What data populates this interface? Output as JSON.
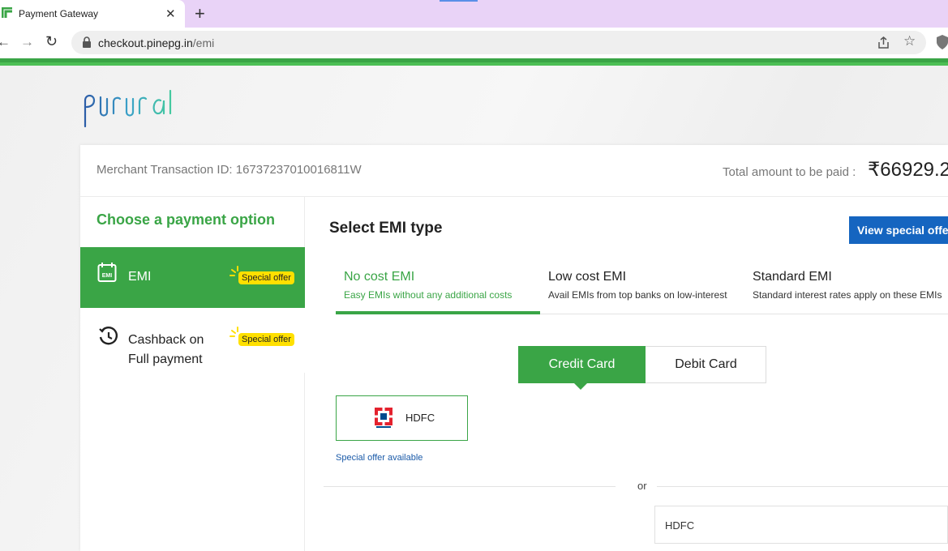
{
  "browser": {
    "tab_title": "Payment Gateway",
    "url_host": "checkout.pinepg.in",
    "url_path": "/emi"
  },
  "header": {
    "merchant_txn": "Merchant Transaction ID: 16737237010016811W",
    "total_label": "Total amount to be paid :",
    "total_amount": "₹66929.2"
  },
  "sidebar": {
    "title": "Choose a payment option",
    "options": [
      {
        "label": "EMI",
        "badge": "Special offer",
        "active": true
      },
      {
        "label": "Cashback on Full payment",
        "badge": "Special offer",
        "active": false
      }
    ]
  },
  "main": {
    "title": "Select EMI type",
    "offers_button": "View special offer",
    "emi_types": [
      {
        "title": "No cost EMI",
        "subtitle": "Easy EMIs without any additional costs",
        "active": true
      },
      {
        "title": "Low cost EMI",
        "subtitle": "Avail EMIs from top banks on low-interest",
        "active": false
      },
      {
        "title": "Standard EMI",
        "subtitle": "Standard interest rates apply on these EMIs",
        "active": false
      }
    ],
    "card_toggle": {
      "credit": "Credit Card",
      "debit": "Debit Card"
    },
    "bank_tile": {
      "name": "HDFC"
    },
    "special_available": "Special offer available",
    "or_text": "or",
    "bank_select_value": "HDFC"
  },
  "colors": {
    "brand_green": "#3aa546",
    "offer_blue": "#1565c0",
    "badge_yellow": "#ffe000",
    "hdfc_red": "#e4222e",
    "hdfc_blue": "#004c8f"
  }
}
